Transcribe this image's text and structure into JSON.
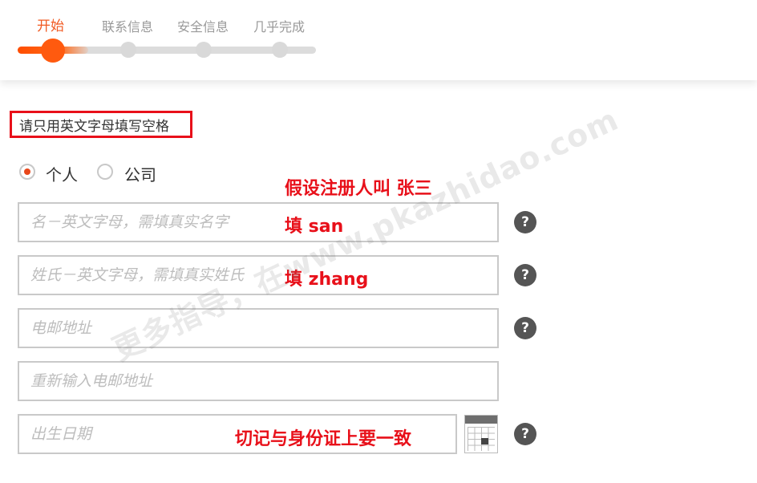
{
  "steps": [
    {
      "label": "开始",
      "active": true
    },
    {
      "label": "联系信息",
      "active": false
    },
    {
      "label": "安全信息",
      "active": false
    },
    {
      "label": "几乎完成",
      "active": false
    }
  ],
  "note": "请只用英文字母填写空格",
  "account_type": {
    "options": [
      "个人",
      "公司"
    ],
    "selected": "个人"
  },
  "fields": {
    "first_name_placeholder": "名－英文字母，需填真实名字",
    "last_name_placeholder": "姓氏－英文字母，需填真实姓氏",
    "email_placeholder": "电邮地址",
    "email_confirm_placeholder": "重新输入电邮地址",
    "birthdate_placeholder": "出生日期"
  },
  "help_icon_glyph": "?",
  "annotations": {
    "assume": "假设注册人叫 张三",
    "first_name": "填 san",
    "last_name": "填 zhang",
    "birthdate": "切记与身份证上要一致"
  },
  "watermark": "更多指导，在www.pkazhidao.com",
  "colors": {
    "accent": "#f15a22",
    "annotation": "#e8101a"
  },
  "icons": [
    "radio-checked-icon",
    "radio-unchecked-icon",
    "help-icon",
    "calendar-icon"
  ]
}
